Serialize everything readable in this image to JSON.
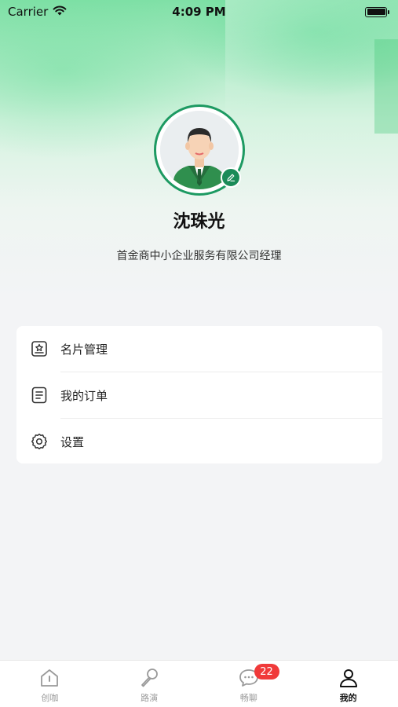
{
  "status_bar": {
    "carrier": "Carrier",
    "time": "4:09 PM",
    "icons": [
      "wifi-icon",
      "battery-icon"
    ]
  },
  "profile": {
    "name": "沈珠光",
    "title": "首金商中小企业服务有限公司经理",
    "avatar_icon": "avatar-man-in-suit",
    "edit_icon": "pencil-edit-icon",
    "accent_color": "#1d9a62"
  },
  "menu": {
    "items": [
      {
        "label": "名片管理",
        "icon": "business-card-icon"
      },
      {
        "label": "我的订单",
        "icon": "order-list-icon"
      },
      {
        "label": "设置",
        "icon": "gear-icon"
      }
    ]
  },
  "tab_bar": {
    "tabs": [
      {
        "label": "创咖",
        "icon": "home-icon",
        "active": false
      },
      {
        "label": "路演",
        "icon": "microphone-icon",
        "active": false
      },
      {
        "label": "畅聊",
        "icon": "chat-bubble-icon",
        "active": false,
        "badge": "22"
      },
      {
        "label": "我的",
        "icon": "person-icon",
        "active": true
      }
    ],
    "badge_color": "#f03a3a"
  }
}
